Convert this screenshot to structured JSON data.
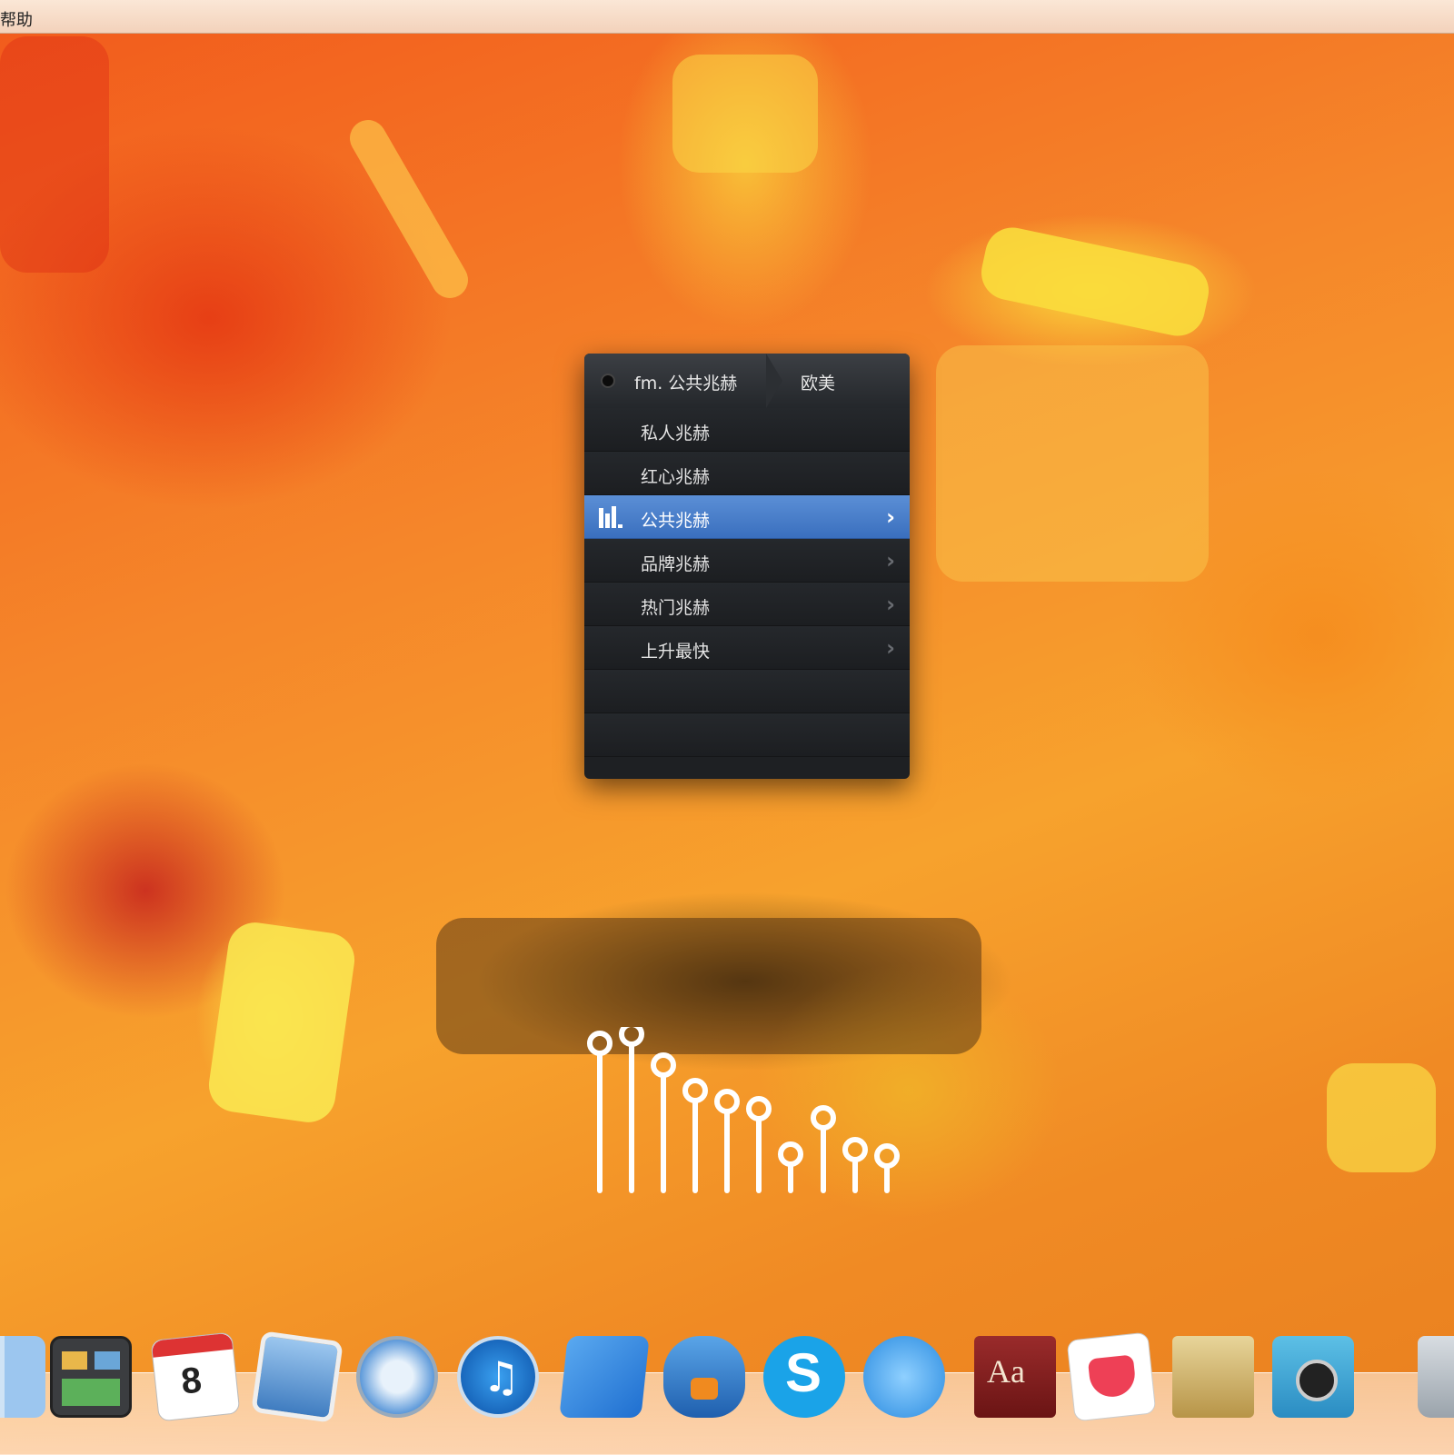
{
  "menubar": {
    "title": "帮助"
  },
  "fm_panel": {
    "breadcrumb": "fm. 公共兆赫",
    "sub_category": "欧美",
    "items": [
      {
        "label": "私人兆赫",
        "has_submenu": false
      },
      {
        "label": "红心兆赫",
        "has_submenu": false
      },
      {
        "label": "公共兆赫",
        "has_submenu": true,
        "selected": true
      },
      {
        "label": "品牌兆赫",
        "has_submenu": true
      },
      {
        "label": "热门兆赫",
        "has_submenu": true
      },
      {
        "label": "上升最快",
        "has_submenu": true
      }
    ],
    "selected_color": "#4a7fcf"
  },
  "dock": {
    "calendar_day": "8",
    "dictionary_label": "Aa",
    "apps": [
      "finder-icon",
      "mission-control-icon",
      "calendar-icon",
      "preview-icon",
      "safari-icon",
      "itunes-icon",
      "xcode-icon",
      "tweetbot-icon",
      "skype-icon",
      "messages-icon",
      "dictionary-icon",
      "pocket-icon",
      "archive-icon",
      "photo-booth-icon",
      "trash-icon"
    ]
  }
}
